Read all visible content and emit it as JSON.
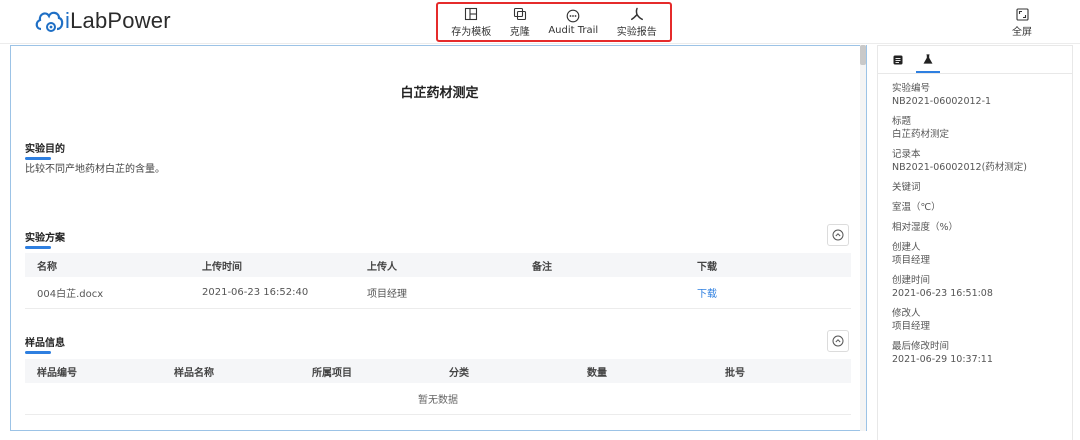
{
  "logo": {
    "prefix": "i",
    "text": "LabPower"
  },
  "toolbar": {
    "items": [
      {
        "label": "存为模板",
        "icon": "template-icon"
      },
      {
        "label": "克隆",
        "icon": "clone-icon"
      },
      {
        "label": "Audit Trail",
        "icon": "audit-trail-icon"
      },
      {
        "label": "实验报告",
        "icon": "pdf-report-icon"
      }
    ]
  },
  "fullscreen": {
    "label": "全屏",
    "icon": "fullscreen-icon"
  },
  "document": {
    "title": "白芷药材测定",
    "purpose": {
      "heading": "实验目的",
      "text": "比较不同产地药材白芷的含量。"
    },
    "plan": {
      "heading": "实验方案",
      "columns": [
        "名称",
        "上传时间",
        "上传人",
        "备注",
        "下载"
      ],
      "rows": [
        {
          "name": "004白芷.docx",
          "time": "2021-06-23 16:52:40",
          "uploader": "项目经理",
          "note": "",
          "download": "下载"
        }
      ]
    },
    "samples": {
      "heading": "样品信息",
      "columns": [
        "样品编号",
        "样品名称",
        "所属项目",
        "分类",
        "数量",
        "批号"
      ],
      "empty": "暂无数据"
    }
  },
  "sidepanel": {
    "tabs": [
      {
        "icon": "info-icon",
        "active": false
      },
      {
        "icon": "flask-icon",
        "active": true
      }
    ],
    "props": [
      {
        "key": "实验编号",
        "value": "NB2021-06002012-1"
      },
      {
        "key": "标题",
        "value": "白芷药材测定"
      },
      {
        "key": "记录本",
        "value": "NB2021-06002012(药材测定)"
      },
      {
        "key": "关键词",
        "value": ""
      },
      {
        "key": "室温（℃）",
        "value": ""
      },
      {
        "key": "相对湿度（%）",
        "value": ""
      },
      {
        "key": "创建人",
        "value": "项目经理"
      },
      {
        "key": "创建时间",
        "value": "2021-06-23 16:51:08"
      },
      {
        "key": "修改人",
        "value": "项目经理"
      },
      {
        "key": "最后修改时间",
        "value": "2021-06-29 10:37:11"
      }
    ]
  },
  "colors": {
    "accent": "#2e7fe0",
    "highlight_border": "#e52b2b"
  }
}
